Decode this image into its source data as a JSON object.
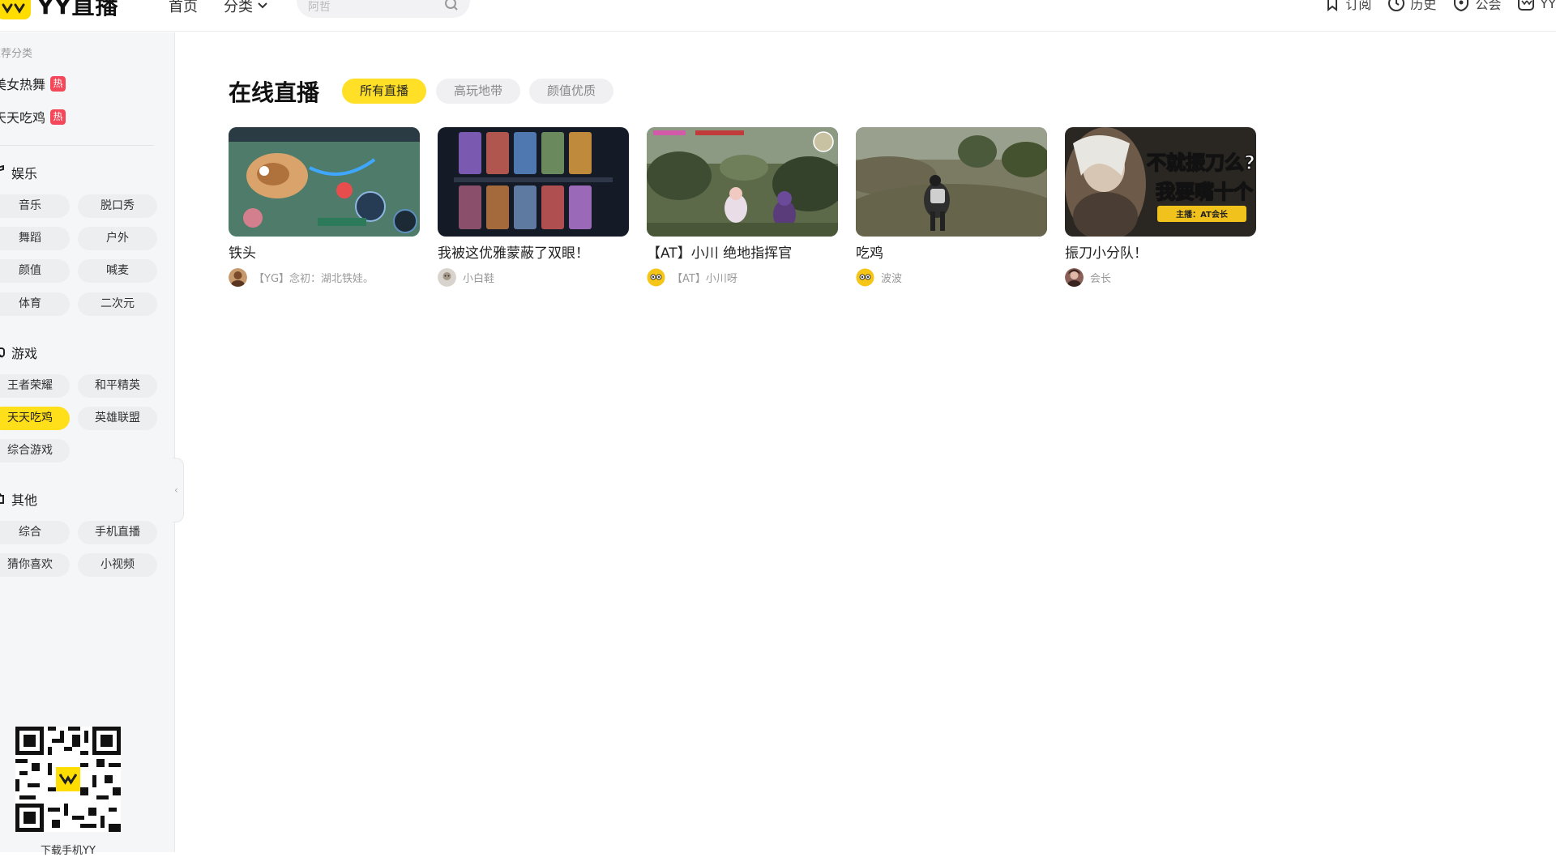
{
  "header": {
    "logo_text": "YY直播",
    "nav": {
      "home": "首页",
      "category": "分类"
    },
    "search": {
      "placeholder": "阿哲"
    },
    "links": [
      {
        "label": "订阅",
        "icon": "bookmark-icon"
      },
      {
        "label": "历史",
        "icon": "clock-icon"
      },
      {
        "label": "公会",
        "icon": "guild-shield-icon"
      },
      {
        "label": "YY",
        "icon": "yy-app-icon"
      }
    ]
  },
  "sidebar": {
    "recommend_title": "推荐分类",
    "recommend": [
      {
        "label": "美女热舞",
        "badge": "热"
      },
      {
        "label": "天天吃鸡",
        "badge": "热"
      }
    ],
    "sections": [
      {
        "title": "娱乐",
        "icon": "music-note-icon",
        "items": [
          "音乐",
          "脱口秀",
          "舞蹈",
          "户外",
          "颜值",
          "喊麦",
          "体育",
          "二次元"
        ]
      },
      {
        "title": "游戏",
        "icon": "gamepad-icon",
        "items": [
          "王者荣耀",
          "和平精英",
          "天天吃鸡",
          "英雄联盟",
          "综合游戏"
        ]
      },
      {
        "title": "其他",
        "icon": "puzzle-icon",
        "items": [
          "综合",
          "手机直播",
          "猜你喜欢",
          "小视频"
        ]
      }
    ],
    "active_item": "天天吃鸡",
    "qr_label": "下载手机YY"
  },
  "main": {
    "title": "在线直播",
    "tabs": [
      {
        "label": "所有直播",
        "active": true
      },
      {
        "label": "高玩地带",
        "active": false
      },
      {
        "label": "颜值优质",
        "active": false
      }
    ],
    "cards": [
      {
        "title": "铁头",
        "streamer": "【YG】念初：湖北铁娃。"
      },
      {
        "title": "我被这优雅蒙蔽了双眼！",
        "streamer": "小白鞋"
      },
      {
        "title": "【AT】小川 绝地指挥官",
        "streamer": "【AT】小川呀"
      },
      {
        "title": "吃鸡",
        "streamer": "波波"
      },
      {
        "title": "振刀小分队！",
        "streamer": "会长",
        "thumb_caption_1": "不就振刀么?",
        "thumb_caption_2": "我要嘴十个",
        "thumb_badge": "主播：AT会长"
      }
    ]
  },
  "colors": {
    "accent": "#ffdf1a",
    "hot_badge": "#f4485a",
    "sidebar_bg": "#f5f6f8"
  }
}
